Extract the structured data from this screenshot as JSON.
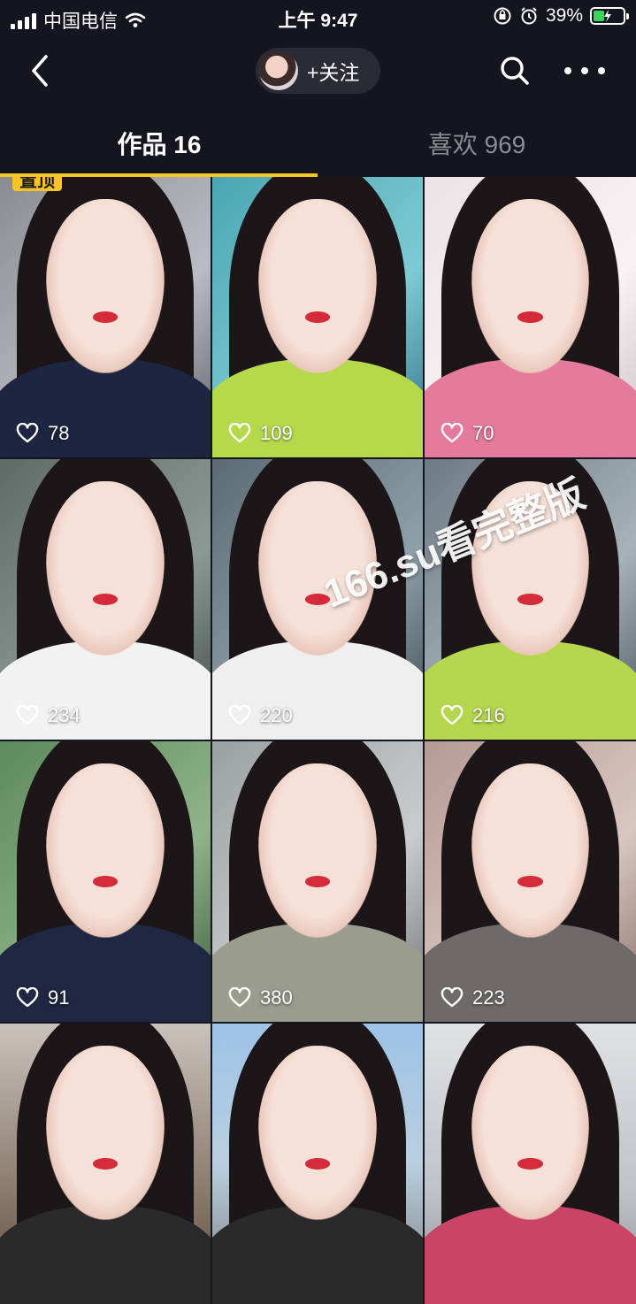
{
  "status_bar": {
    "carrier": "中国电信",
    "time": "上午 9:47",
    "battery_percent": "39%",
    "battery_level": 0.39
  },
  "nav": {
    "follow_label": "+关注"
  },
  "tabs": [
    {
      "label": "作品 16",
      "active": true
    },
    {
      "label": "喜欢 969",
      "active": false
    }
  ],
  "pinned_badge": "置顶",
  "videos": [
    {
      "likes": "78"
    },
    {
      "likes": "109"
    },
    {
      "likes": "70"
    },
    {
      "likes": "234"
    },
    {
      "likes": "220"
    },
    {
      "likes": "216"
    },
    {
      "likes": "91"
    },
    {
      "likes": "380"
    },
    {
      "likes": "223"
    },
    {
      "likes": ""
    },
    {
      "likes": ""
    },
    {
      "likes": ""
    }
  ],
  "watermark": "166.su看完整版",
  "colors": {
    "background": "#15151f",
    "tab_indicator": "#f7c325",
    "battery_fill": "#3ad45a"
  }
}
